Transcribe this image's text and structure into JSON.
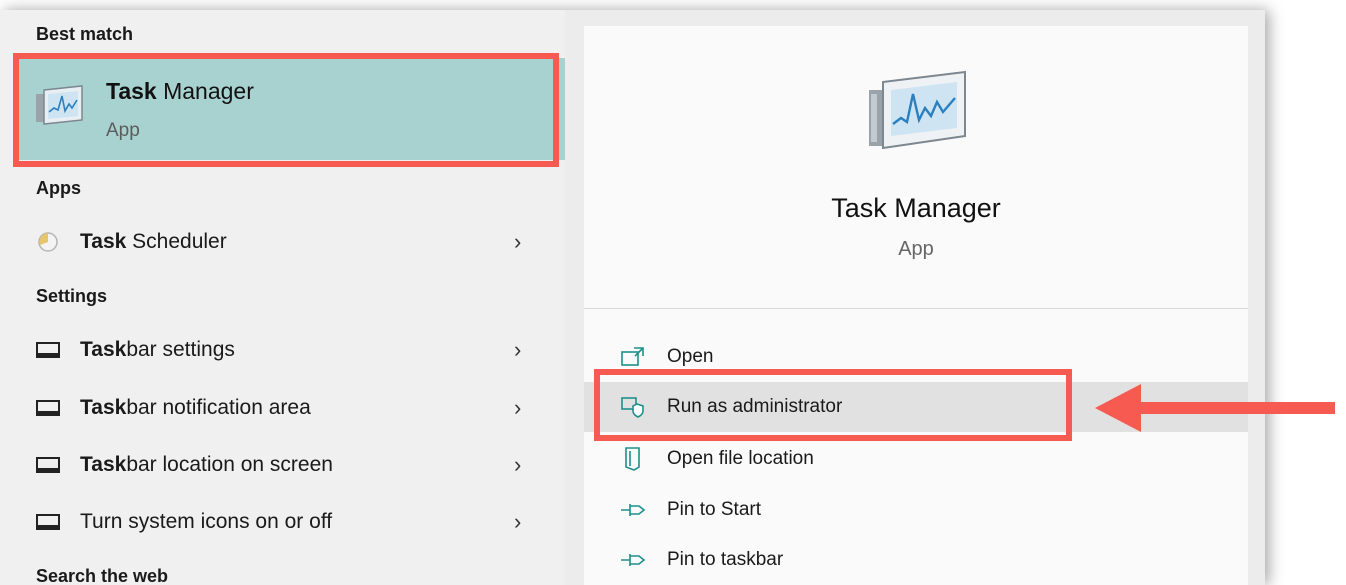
{
  "best_match": {
    "section_label": "Best match",
    "name_bold": "Task",
    "name_rest": " Manager",
    "type": "App"
  },
  "apps": {
    "section_label": "Apps",
    "items": [
      {
        "bold": "Task",
        "rest": " Scheduler",
        "icon": "clock-icon"
      }
    ]
  },
  "settings": {
    "section_label": "Settings",
    "items": [
      {
        "bold": "Task",
        "rest": "bar settings",
        "icon": "taskbar-icon"
      },
      {
        "bold": "Task",
        "rest": "bar notification area",
        "icon": "taskbar-icon"
      },
      {
        "bold": "Task",
        "rest": "bar location on screen",
        "icon": "taskbar-icon"
      },
      {
        "bold": "",
        "rest": "Turn system icons on or off",
        "icon": "taskbar-icon"
      }
    ]
  },
  "web": {
    "section_label": "Search the web"
  },
  "preview": {
    "title": "Task Manager",
    "subtitle": "App",
    "actions": [
      {
        "label": "Open",
        "icon": "open-icon"
      },
      {
        "label": "Run as administrator",
        "icon": "shield-icon"
      },
      {
        "label": "Open file location",
        "icon": "folder-icon"
      },
      {
        "label": "Pin to Start",
        "icon": "pin-icon"
      },
      {
        "label": "Pin to taskbar",
        "icon": "pin-icon"
      }
    ]
  },
  "colors": {
    "selected_bg": "#a8d2d0",
    "highlight": "#f65a51",
    "accent": "#1f8f8a"
  }
}
